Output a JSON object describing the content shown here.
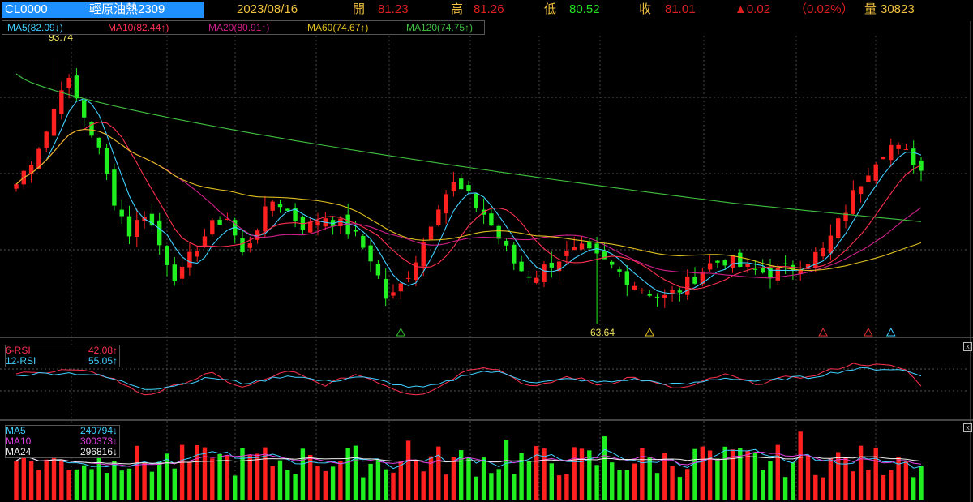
{
  "header": {
    "symbol": "CL0000",
    "name": "輕原油熱2309",
    "date": "2023/08/16",
    "open_label": "開",
    "open": "81.23",
    "high_label": "高",
    "high": "81.26",
    "low_label": "低",
    "low": "80.52",
    "close_label": "收",
    "close": "81.01",
    "change": "▲0.02",
    "change_pct": "（0.02%）",
    "volume_label": "量",
    "volume": "30823"
  },
  "ma_legend": {
    "ma5": "MA5(82.09↓)",
    "ma10": "MA10(82.44↑)",
    "ma20": "MA20(80.91↑)",
    "ma60": "MA60(74.67↑)",
    "ma120": "MA120(74.75↑)"
  },
  "rsi_legend": {
    "rsi6_label": "6-RSI",
    "rsi6_value": "42.08↑",
    "rsi12_label": "12-RSI",
    "rsi12_value": "55.05↑"
  },
  "vol_legend": {
    "ma5_label": "MA5",
    "ma5_value": "240794↓",
    "ma10_label": "MA10",
    "ma10_value": "300373↓",
    "ma24_label": "MA24",
    "ma24_value": "296816↓"
  },
  "annotations": {
    "high_label": "93.74",
    "low_label": "63.64"
  },
  "colors": {
    "up": "#ff2020",
    "down": "#20f020",
    "ma5": "#40d0ff",
    "ma10": "#ff3050",
    "ma20": "#d0208a",
    "ma60": "#e0c020",
    "ma120": "#40c040",
    "bg": "#000000"
  },
  "chart_data": {
    "type": "candlestick",
    "title": "輕原油熱2309",
    "y_range": [
      62.5,
      96.5
    ],
    "price_high": 93.74,
    "price_low": 63.64,
    "anchor_closes": [
      79.5,
      82.5,
      86.0,
      92.0,
      88.0,
      84.0,
      78.0,
      74.0,
      76.5,
      72.0,
      68.5,
      72.0,
      74.5,
      76.0,
      71.5,
      75.0,
      78.0,
      76.0,
      74.5,
      76.0,
      75.0,
      73.5,
      71.0,
      66.0,
      68.5,
      72.0,
      77.0,
      79.5,
      78.0,
      76.0,
      73.0,
      70.0,
      69.0,
      70.5,
      71.5,
      72.0,
      71.0,
      70.0,
      68.5,
      67.5,
      66.5,
      67.5,
      69.0,
      70.5,
      71.0,
      70.0,
      69.5,
      69.5,
      70.0,
      71.0,
      72.0,
      75.5,
      79.0,
      82.0,
      84.0,
      83.0,
      81.5
    ],
    "rsi_range": [
      0,
      100
    ],
    "rsi6": [
      57,
      62,
      59,
      63,
      61,
      58,
      52,
      40,
      31,
      36,
      44,
      51,
      59,
      49,
      40,
      47,
      56,
      61,
      52,
      43,
      50,
      57,
      51,
      42,
      34,
      32,
      39,
      52,
      64,
      67,
      62,
      50,
      40,
      46,
      54,
      51,
      44,
      47,
      54,
      49,
      43,
      39,
      43,
      52,
      57,
      49,
      45,
      50,
      55,
      53,
      60,
      66,
      71,
      69,
      68,
      64,
      42.08
    ],
    "rsi12": [
      55,
      58,
      58,
      59,
      58,
      56,
      51,
      45,
      39,
      40,
      44,
      48,
      53,
      50,
      46,
      48,
      53,
      56,
      52,
      48,
      50,
      54,
      51,
      47,
      42,
      40,
      43,
      50,
      58,
      61,
      59,
      53,
      47,
      48,
      51,
      50,
      47,
      48,
      51,
      49,
      46,
      44,
      46,
      50,
      53,
      50,
      48,
      50,
      53,
      53,
      57,
      61,
      64,
      64,
      64,
      62,
      55.05
    ],
    "volume_ma": {
      "MA5": 240794,
      "MA10": 300373,
      "MA24": 296816
    },
    "signal_markers": [
      {
        "index": 51,
        "direction": "up",
        "color": "#30c030"
      },
      {
        "index": 84,
        "direction": "up",
        "color": "#e0c020"
      },
      {
        "index": 107,
        "direction": "up",
        "color": "#e03030"
      },
      {
        "index": 113,
        "direction": "up",
        "color": "#e03030"
      },
      {
        "index": 116,
        "direction": "up",
        "color": "#40d0ff"
      }
    ]
  }
}
